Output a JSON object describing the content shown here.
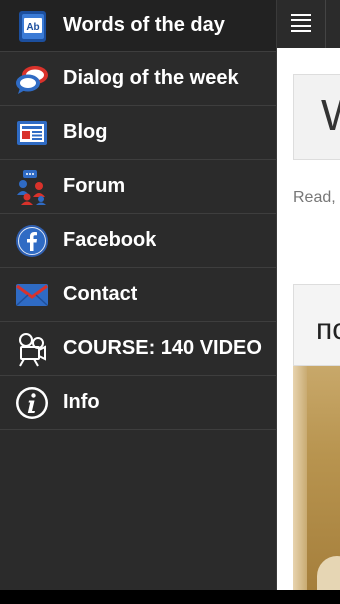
{
  "menu": {
    "items": [
      {
        "label": "Words of the day",
        "icon": "ab-book-icon"
      },
      {
        "label": "Dialog of the week",
        "icon": "speech-bubbles-icon"
      },
      {
        "label": "Blog",
        "icon": "newspaper-icon"
      },
      {
        "label": "Forum",
        "icon": "people-chat-icon"
      },
      {
        "label": "Facebook",
        "icon": "facebook-icon"
      },
      {
        "label": "Contact",
        "icon": "envelope-icon"
      },
      {
        "label": "COURSE: 140 VIDEO",
        "icon": "video-camera-icon"
      },
      {
        "label": "Info",
        "icon": "info-icon"
      }
    ]
  },
  "main": {
    "word_box_text": "W",
    "description": "Read, words Russia",
    "card_title": "по"
  },
  "colors": {
    "drawer_bg": "#2b2b2b",
    "accent_blue": "#2f6bc4",
    "accent_red": "#d9322b"
  }
}
